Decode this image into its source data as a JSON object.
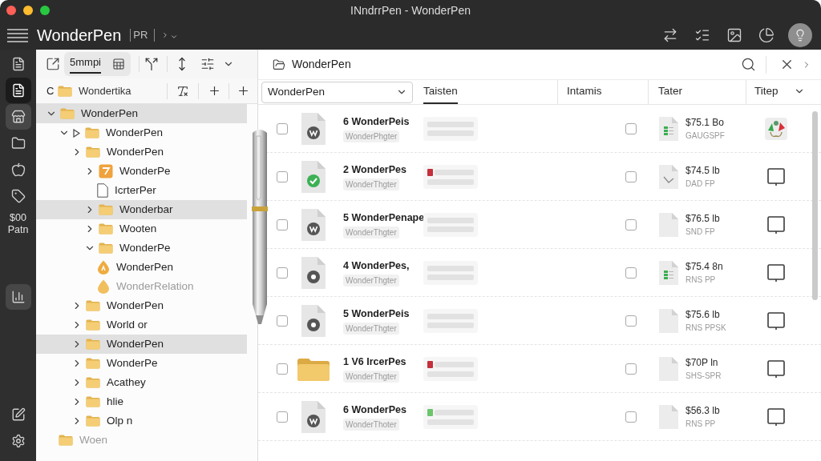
{
  "window": {
    "title": "INndrrPen - WonderPen"
  },
  "toolbar": {
    "app_name": "WonderPen",
    "badge": "PR"
  },
  "rail": {
    "upper_items": [
      {
        "selected": false,
        "highlighted": false
      },
      {
        "selected": true
      },
      {
        "selected": false,
        "highlighted": true
      },
      {
        "selected": false,
        "highlighted": false
      },
      {
        "selected": false,
        "highlighted": false
      },
      {
        "selected": false,
        "highlighted": false
      }
    ],
    "label": "$00 Patn",
    "lower_items": [
      {
        "selected": false,
        "highlighted": true
      }
    ]
  },
  "sidebar": {
    "tabs": [
      {
        "label": "5mmpi",
        "selected": true
      }
    ],
    "path": {
      "drive": "C",
      "folder": "Wondertika"
    },
    "tree": [
      {
        "kind": "folder",
        "label": "WonderPen",
        "expanded": true,
        "selected": true,
        "dimmed": false,
        "children": [
          {
            "kind": "folder-linked",
            "label": "WonderPen",
            "expanded": true,
            "selected": false,
            "dimmed": false,
            "children": [
              {
                "kind": "folder",
                "label": "WonderPen",
                "expanded": false,
                "selected": false,
                "dimmed": false,
                "children": [
                  {
                    "kind": "note",
                    "label": "WonderPe",
                    "expanded": false,
                    "selected": false,
                    "dimmed": false,
                    "children": [
                      {
                        "kind": "file",
                        "label": "IcrterPer",
                        "selected": false,
                        "dimmed": false
                      }
                    ]
                  },
                  {
                    "kind": "folder",
                    "label": "Wonderbar",
                    "expanded": false,
                    "selected": true,
                    "dimmed": false
                  },
                  {
                    "kind": "folder",
                    "label": "Wooten",
                    "expanded": false,
                    "selected": false,
                    "dimmed": false
                  },
                  {
                    "kind": "folder",
                    "label": "WonderPe",
                    "expanded": true,
                    "selected": false,
                    "dimmed": false,
                    "children": [
                      {
                        "kind": "drop-badge",
                        "label": "WonderPen",
                        "selected": false,
                        "dimmed": false
                      },
                      {
                        "kind": "drop",
                        "label": "WonderRelation",
                        "selected": false,
                        "dimmed": true
                      }
                    ]
                  }
                ]
              },
              {
                "kind": "folder",
                "label": "WonderPen",
                "expanded": false,
                "selected": false,
                "dimmed": false
              },
              {
                "kind": "folder",
                "label": "World or",
                "expanded": false,
                "selected": false,
                "dimmed": false
              },
              {
                "kind": "folder",
                "label": "WonderPen",
                "expanded": false,
                "selected": true,
                "dimmed": false
              },
              {
                "kind": "folder",
                "label": "WonderPe",
                "expanded": false,
                "selected": false,
                "dimmed": false
              },
              {
                "kind": "folder",
                "label": "Acathey",
                "expanded": false,
                "selected": false,
                "dimmed": false
              },
              {
                "kind": "folder",
                "label": "hlie",
                "expanded": false,
                "selected": false,
                "dimmed": false
              },
              {
                "kind": "folder",
                "label": "Olp n",
                "expanded": false,
                "selected": false,
                "dimmed": false
              }
            ]
          },
          {
            "kind": "folder",
            "label": "Woen",
            "selected": false,
            "dimmed": true
          }
        ]
      }
    ]
  },
  "content": {
    "title": "WonderPen",
    "filter": {
      "value": "WonderPen"
    },
    "columns": [
      {
        "label": "Taisten",
        "selected": true,
        "menu": false
      },
      {
        "label": "Intamis",
        "selected": false,
        "menu": false
      },
      {
        "label": "Tater",
        "selected": false,
        "menu": false
      },
      {
        "label": "Titep",
        "selected": false,
        "menu": true
      }
    ],
    "rows": [
      {
        "checked": false,
        "file": {
          "kind": "doc-logo"
        },
        "title": "6 WonderPeis",
        "subtitle": "WonderPhgter",
        "right_checked": false,
        "type": {
          "kind": "sheet"
        },
        "price": "$75.1 Bo",
        "code": "GAUGSPF",
        "action": {
          "kind": "recycle"
        }
      },
      {
        "checked": false,
        "file": {
          "kind": "doc-check"
        },
        "title": "2 WonderPes",
        "subtitle": "WonderThgter",
        "marker": {
          "color": "#c4303b"
        },
        "right_checked": false,
        "type": {
          "kind": "check"
        },
        "price": "$74.5 lb",
        "code": "DAD FP",
        "action": {
          "kind": "comment"
        }
      },
      {
        "checked": false,
        "file": {
          "kind": "doc-logo"
        },
        "title": "5 WonderPenape",
        "subtitle": "WonderThgter",
        "right_checked": false,
        "type": {
          "kind": "blank"
        },
        "price": "$76.5 lb",
        "code": "SND FP",
        "action": {
          "kind": "comment"
        }
      },
      {
        "checked": false,
        "file": {
          "kind": "doc-dot"
        },
        "title": "4 WonderPes,",
        "subtitle": "WonderThgter",
        "right_checked": false,
        "type": {
          "kind": "sheet"
        },
        "price": "$75.4 8n",
        "code": "RNS PP",
        "action": {
          "kind": "comment"
        }
      },
      {
        "checked": false,
        "file": {
          "kind": "doc-dot"
        },
        "title": "5 WonderPeis",
        "subtitle": "WonderThgter",
        "right_checked": false,
        "type": {
          "kind": "blank"
        },
        "price": "$75.6 lb",
        "code": "RNS PPSK",
        "action": {
          "kind": "comment"
        }
      },
      {
        "checked": false,
        "file": {
          "kind": "folder"
        },
        "title": "1 V6 IrcerPes",
        "subtitle": "WonderThgter",
        "marker": {
          "color": "#c4303b"
        },
        "right_checked": false,
        "type": {
          "kind": "blank"
        },
        "price": "$70P ln",
        "code": "SHS-SPR",
        "action": {
          "kind": "comment"
        }
      },
      {
        "checked": false,
        "file": {
          "kind": "doc-logo"
        },
        "title": "6 WonderPes",
        "subtitle": "WonderThoter",
        "marker": {
          "color": "#6cc56c"
        },
        "right_checked": false,
        "type": {
          "kind": "blank"
        },
        "price": "$56.3 lb",
        "code": "RNS PP",
        "action": {
          "kind": "comment"
        }
      }
    ]
  }
}
